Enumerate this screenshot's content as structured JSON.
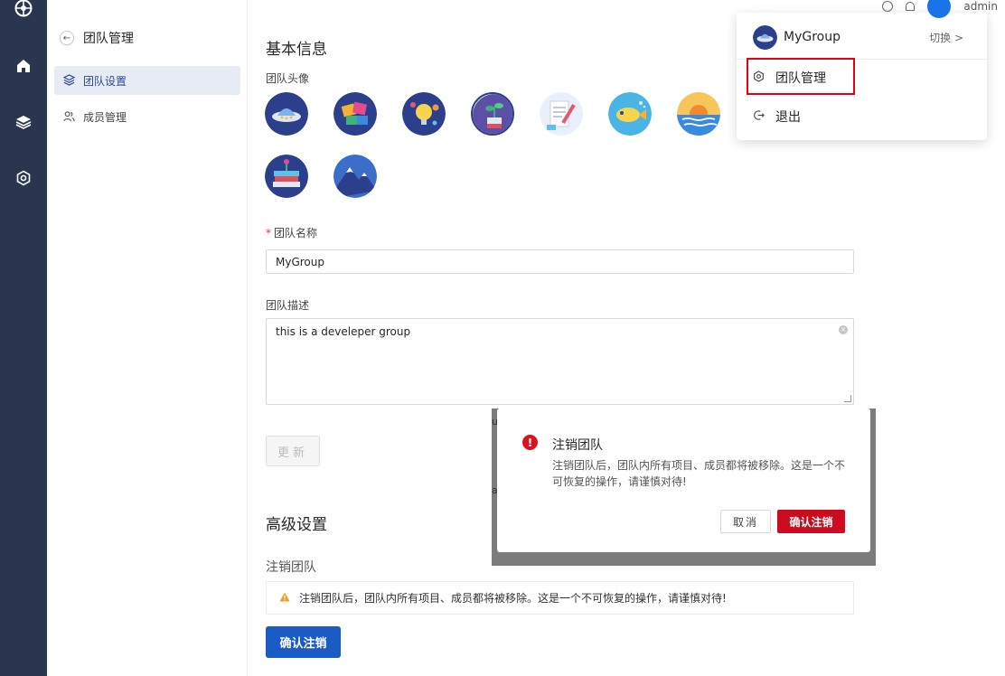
{
  "rail": {
    "icons": [
      "logo-icon",
      "home-icon",
      "layers-icon",
      "settings-hex-icon"
    ]
  },
  "subnav": {
    "title": "团队管理",
    "items": [
      {
        "label": "团队设置",
        "icon": "layers-icon",
        "active": true
      },
      {
        "label": "成员管理",
        "icon": "users-icon",
        "active": false
      }
    ]
  },
  "header": {
    "user_label": "admin"
  },
  "main": {
    "basic_title": "基本信息",
    "avatar_label": "团队头像",
    "avatars": [
      "ufo",
      "colorful-blocks",
      "lightbulb-planets",
      "plant-pot",
      "notebook-pen",
      "yellow-fish",
      "sunset-sea",
      "stacked-books",
      "snow-mountain"
    ],
    "name_label": "团队名称",
    "name_value": "MyGroup",
    "desc_label": "团队描述",
    "desc_value": "this is a develeper group",
    "update_button": "更新",
    "advanced_title": "高级设置",
    "cancel_team_title": "注销团队",
    "warning_text": "注销团队后，团队内所有项目、成员都将被移除。这是一个不可恢复的操作，请谨慎对待!",
    "confirm_button": "确认注销"
  },
  "dropdown": {
    "group_name": "MyGroup",
    "switch_label": "切换 >",
    "items": [
      {
        "label": "团队管理",
        "icon": "gear-icon"
      },
      {
        "label": "退出",
        "icon": "logout-icon"
      }
    ]
  },
  "modal": {
    "title": "注销团队",
    "body": "注销团队后，团队内所有项目、成员都将被移除。这是一个不可恢复的操作，请谨慎对待!",
    "cancel_label": "取消",
    "ok_label": "确认注销"
  },
  "colors": {
    "rail": "#2a3550",
    "primary": "#1b5bc6",
    "danger": "#cc0c1e",
    "highlight": "#e60012"
  }
}
